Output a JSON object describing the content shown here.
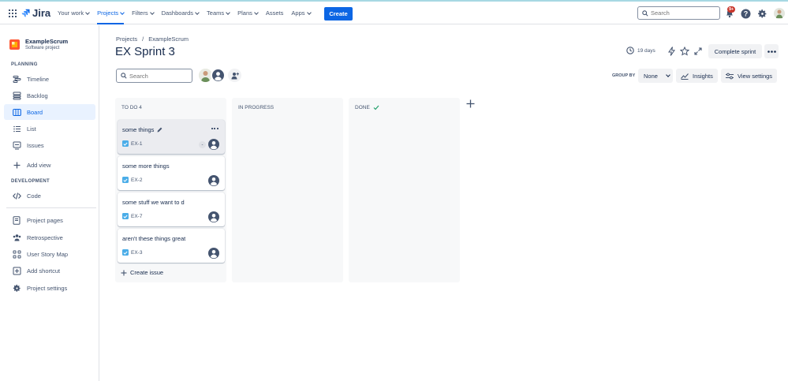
{
  "topnav": {
    "logo": "Jira",
    "items": [
      {
        "label": "Your work",
        "dropdown": true,
        "active": false
      },
      {
        "label": "Projects",
        "dropdown": true,
        "active": true
      },
      {
        "label": "Filters",
        "dropdown": true,
        "active": false
      },
      {
        "label": "Dashboards",
        "dropdown": true,
        "active": false
      },
      {
        "label": "Teams",
        "dropdown": true,
        "active": false
      },
      {
        "label": "Plans",
        "dropdown": true,
        "active": false
      },
      {
        "label": "Assets",
        "dropdown": false,
        "active": false
      },
      {
        "label": "Apps",
        "dropdown": true,
        "active": false
      }
    ],
    "create_label": "Create",
    "search_placeholder": "Search",
    "notifications_badge": "9+",
    "accent": "#0c66e4"
  },
  "sidebar": {
    "project_name": "ExampleScrum",
    "project_type": "Software project",
    "planning_label": "PLANNING",
    "planning_items": [
      {
        "label": "Timeline",
        "icon": "timeline-icon",
        "selected": false
      },
      {
        "label": "Backlog",
        "icon": "backlog-icon",
        "selected": false
      },
      {
        "label": "Board",
        "icon": "board-icon",
        "selected": true
      },
      {
        "label": "List",
        "icon": "list-icon",
        "selected": false
      },
      {
        "label": "Issues",
        "icon": "issues-icon",
        "selected": false
      }
    ],
    "add_view_label": "Add view",
    "development_label": "DEVELOPMENT",
    "code_label": "Code",
    "bottom_items": [
      {
        "label": "Project pages",
        "icon": "pages-icon"
      },
      {
        "label": "Retrospective",
        "icon": "people-icon"
      },
      {
        "label": "User Story Map",
        "icon": "story-map-icon"
      },
      {
        "label": "Add shortcut",
        "icon": "shortcut-icon"
      },
      {
        "label": "Project settings",
        "icon": "gear-icon"
      }
    ]
  },
  "header": {
    "breadcrumb": [
      "Projects",
      "/",
      "ExampleScrum"
    ],
    "title": "EX Sprint 3",
    "days_remaining": "19 days",
    "complete_sprint_label": "Complete sprint"
  },
  "toolbar": {
    "search_placeholder": "Search",
    "group_by_label": "GROUP BY",
    "group_by_value": "None",
    "insights_label": "Insights",
    "view_settings_label": "View settings"
  },
  "columns": [
    {
      "title": "TO DO 4",
      "done_check": false
    },
    {
      "title": "IN PROGRESS",
      "done_check": false
    },
    {
      "title": "DONE",
      "done_check": true
    }
  ],
  "cards": [
    {
      "title": "some things",
      "key": "EX-1",
      "editable": true,
      "estimate": "-"
    },
    {
      "title": "some more things",
      "key": "EX-2",
      "editable": false,
      "estimate": ""
    },
    {
      "title": "some stuff we want to d",
      "key": "EX-7",
      "editable": false,
      "estimate": ""
    },
    {
      "title": "aren't these things great",
      "key": "EX-3",
      "editable": false,
      "estimate": ""
    }
  ],
  "create_issue_label": "Create issue"
}
